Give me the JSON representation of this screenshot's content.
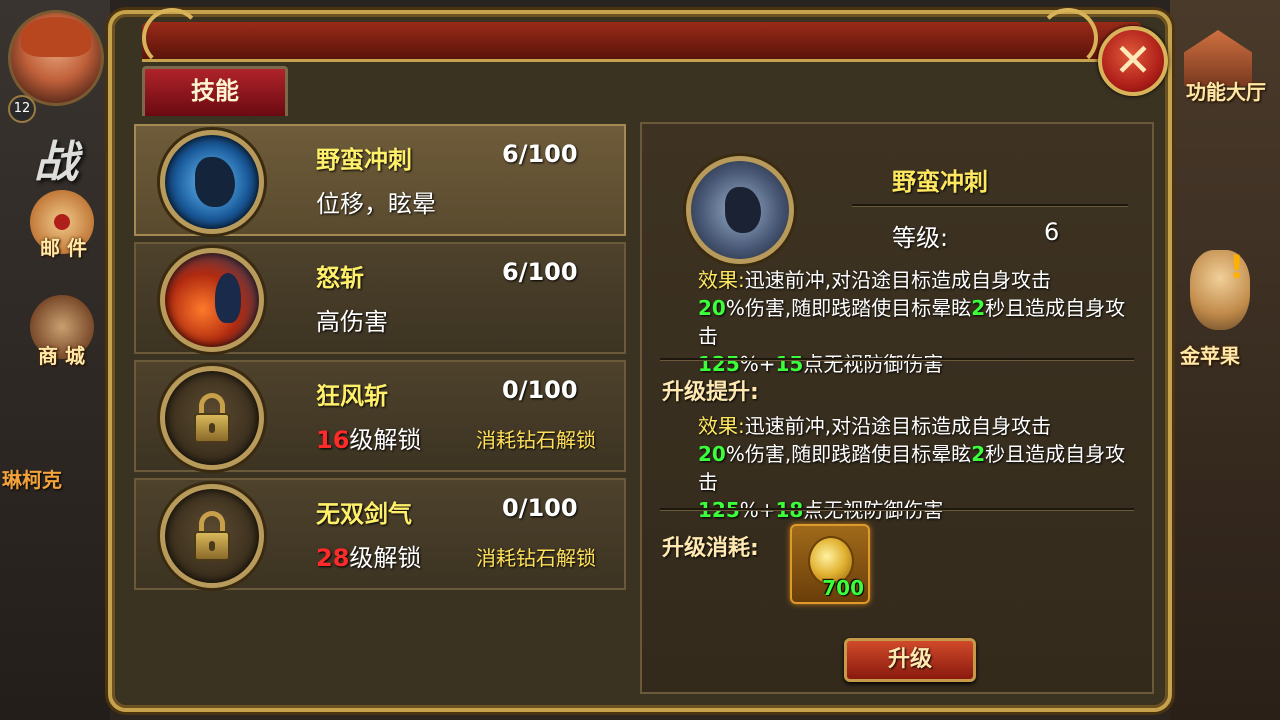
{
  "hud": {
    "player_level": "12",
    "mail_label": "邮 件",
    "shop_label": "商 城",
    "hall_label": "功能大厅",
    "apple_label": "金苹果",
    "apple_alert": "!",
    "side_name": "琳柯克",
    "war_text": "战"
  },
  "dialog": {
    "close_label": "✕",
    "tab_label": "技能"
  },
  "skills": [
    {
      "name": "野蛮冲刺",
      "progress": "6/100",
      "desc": "位移，眩晕",
      "selected": true
    },
    {
      "name": "怒斩",
      "progress": "6/100",
      "desc": "高伤害"
    },
    {
      "name": "狂风斩",
      "progress": "0/100",
      "unlock_level": "16",
      "unlock_suffix": "级解锁",
      "unlock_diamond": "消耗钻石解锁"
    },
    {
      "name": "无双剑气",
      "progress": "0/100",
      "unlock_level": "28",
      "unlock_suffix": "级解锁",
      "unlock_diamond": "消耗钻石解锁"
    }
  ],
  "detail": {
    "title": "野蛮冲刺",
    "level_label": "等级:",
    "level_value": "6",
    "effect_current": {
      "label": "效果:",
      "t1": "迅速前冲,对沿途目标造成自身攻击",
      "n1": "20",
      "t2": "%伤害,随即践踏使目标晕眩",
      "n2": "2",
      "t3": "秒且造成自身攻击",
      "n3": "125",
      "t4": "%+",
      "n4": "15",
      "t5": "点无视防御伤害"
    },
    "upgrade_label": "升级提升:",
    "effect_next": {
      "label": "效果:",
      "t1": "迅速前冲,对沿途目标造成自身攻击",
      "n1": "20",
      "t2": "%伤害,随即践踏使目标晕眩",
      "n2": "2",
      "t3": "秒且造成自身攻击",
      "n3": "125",
      "t4": "%+",
      "n4": "18",
      "t5": "点无视防御伤害"
    },
    "cost_label": "升级消耗:",
    "cost_amount": "700",
    "upgrade_button": "升级"
  }
}
